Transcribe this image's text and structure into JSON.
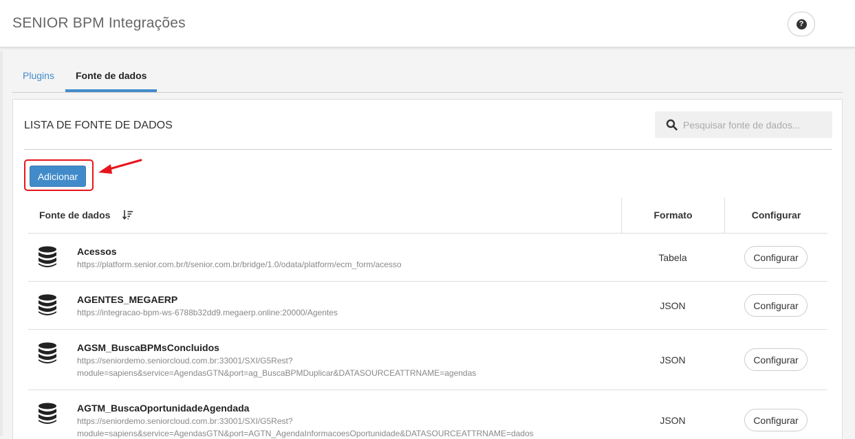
{
  "app": {
    "title": "SENIOR BPM Integrações"
  },
  "header": {
    "help_icon": "question-circle-icon"
  },
  "tabs": [
    {
      "label": "Plugins",
      "active": false
    },
    {
      "label": "Fonte de dados",
      "active": true
    }
  ],
  "panel": {
    "title": "LISTA DE FONTE DE DADOS",
    "search_placeholder": "Pesquisar fonte de dados...",
    "search_value": "",
    "add_label": "Adicionar"
  },
  "table": {
    "columns": {
      "name": "Fonte de dados",
      "format": "Formato",
      "config": "Configurar"
    },
    "rows": [
      {
        "name": "Acessos",
        "url": "https://platform.senior.com.br/t/senior.com.br/bridge/1.0/odata/platform/ecm_form/acesso",
        "format": "Tabela",
        "action": "Configurar"
      },
      {
        "name": "AGENTES_MEGAERP",
        "url": "https://integracao-bpm-ws-6788b32dd9.megaerp.online:20000/Agentes",
        "format": "JSON",
        "action": "Configurar"
      },
      {
        "name": "AGSM_BuscaBPMsConcluidos",
        "url": "https://seniordemo.seniorcloud.com.br:33001/SXI/G5Rest?module=sapiens&service=AgendasGTN&port=ag_BuscaBPMDuplicar&DATASOURCEATTRNAME=agendas",
        "format": "JSON",
        "action": "Configurar"
      },
      {
        "name": "AGTM_BuscaOportunidadeAgendada",
        "url": "https://seniordemo.seniorcloud.com.br:33001/SXI/G5Rest?module=sapiens&service=AgendasGTN&port=AGTN_AgendaInformacoesOportunidade&DATASOURCEATTRNAME=dados",
        "format": "JSON",
        "action": "Configurar"
      }
    ]
  },
  "colors": {
    "accent": "#428bca",
    "highlight": "#e8141c"
  }
}
